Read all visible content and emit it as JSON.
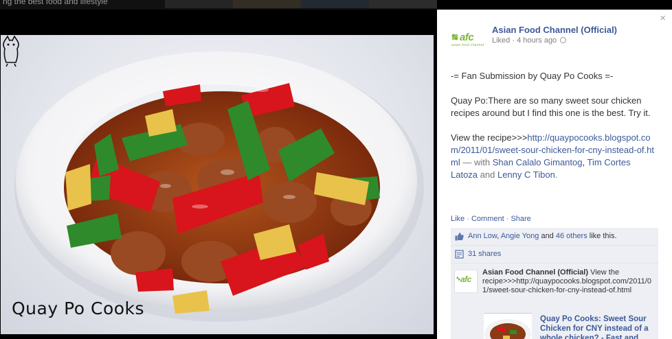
{
  "backdrop": {
    "top_text": "ng the best food and lifestyle"
  },
  "photo": {
    "watermark": "Quay Po Cooks"
  },
  "panel": {
    "close_label": "×",
    "page_name": "Asian Food Channel (Official)",
    "liked_label": "Liked",
    "time_ago": "4 hours ago",
    "logo_text": "afc",
    "logo_subtext": "asian food channel",
    "post": {
      "line1": "-= Fan Submission by Quay Po Cooks =-",
      "line2": "Quay Po:There are so many sweet sour chicken recipes around but I find this one is the best. Try it.",
      "view_prefix": "View the recipe>>>",
      "recipe_url": "http://quaypocooks.blogspot.com/2011/01/sweet-sour-chicken-for-cny-instead-of.html",
      "with_text": " — with ",
      "tag1": "Shan Calalo Gimantog",
      "tag2": "Tim Cortes Latoza",
      "and_text": " and ",
      "tag3": "Lenny C Tibon",
      "period": "."
    },
    "actions": {
      "like": "Like",
      "comment": "Comment",
      "share": "Share",
      "sep": " · "
    },
    "likes": {
      "name1": "Ann Low",
      "comma": ", ",
      "name2": "Angie Yong",
      "and": " and ",
      "others": "46 others",
      "suffix": " like this."
    },
    "shares": {
      "count": "31 shares"
    },
    "shared_post": {
      "author": "Asian Food Channel (Official)",
      "text_prefix": " View the recipe>>>",
      "url": "http://quaypocooks.blogspot.com/2011/01/sweet-sour-chicken-for-cny-instead-of.html",
      "link_title": "Quay Po Cooks: Sweet Sour Chicken for CNY instead of a whole chicken? - Fast and easy"
    }
  },
  "colors": {
    "link_blue": "#3b5998",
    "afc_green": "#7cb63a",
    "likes_bg": "#edeff4"
  }
}
